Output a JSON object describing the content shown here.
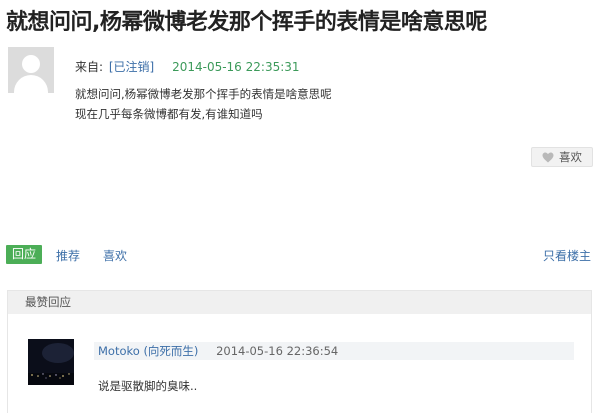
{
  "post": {
    "title": "就想问问,杨幂微博老发那个挥手的表情是啥意思呢",
    "from_label": "来自:",
    "user": "[已注销]",
    "time": "2014-05-16 22:35:31",
    "content": [
      "就想问问,杨幂微博老发那个挥手的表情是啥意思呢",
      "现在几乎每条微博都有发,有谁知道吗"
    ],
    "like_label": "喜欢",
    "like_icon": "heart-icon"
  },
  "actions": {
    "reply": "回应",
    "recommend": "推荐",
    "like": "喜欢",
    "owner_only": "只看楼主"
  },
  "top_replies": {
    "heading": "最赞回应",
    "items": [
      {
        "user": "Motoko (向死而生)",
        "time": "2014-05-16 22:36:54",
        "text": "说是驱散脚的臭味.."
      }
    ]
  },
  "colors": {
    "reply_button": "#4cae57",
    "link": "#3d6fa8",
    "timestamp": "#3c9a5a"
  }
}
